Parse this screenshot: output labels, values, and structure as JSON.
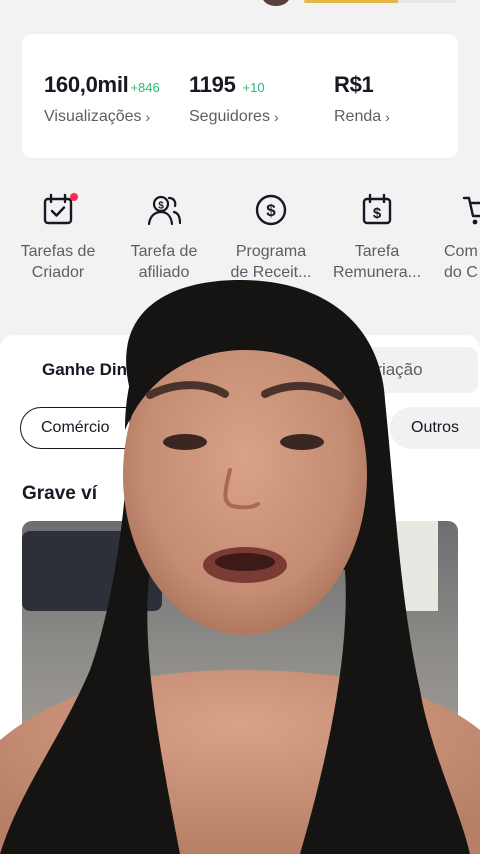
{
  "header": {
    "progress": 0.62
  },
  "stats": {
    "views": {
      "value": "160,0mil",
      "delta": "+846",
      "label": "Visualizações"
    },
    "followers": {
      "value": "1195",
      "delta": "+10",
      "label": "Seguidores"
    },
    "income": {
      "value": "R$1",
      "label": "Renda"
    }
  },
  "tools": [
    {
      "icon": "calendar-check-icon",
      "label": "Tarefas de\nCriador",
      "has_badge": true
    },
    {
      "icon": "affiliate-people-icon",
      "label": "Tarefa de\nafiliado"
    },
    {
      "icon": "dollar-circle-icon",
      "label": "Programa\nde Receit..."
    },
    {
      "icon": "calendar-dollar-icon",
      "label": "Tarefa\nRemunera..."
    },
    {
      "icon": "shopping-cart-icon",
      "label": "Com\ndo C"
    }
  ],
  "sheet": {
    "tab_left": "Ganhe Din",
    "tab_right": "Criação",
    "chip_active": "Comércio",
    "chip_other": "Outros",
    "section_title": "Grave ví"
  },
  "colors": {
    "accent_green": "#20c070",
    "badge_red": "#fe2c55",
    "progress_gold": "#e7b649"
  }
}
